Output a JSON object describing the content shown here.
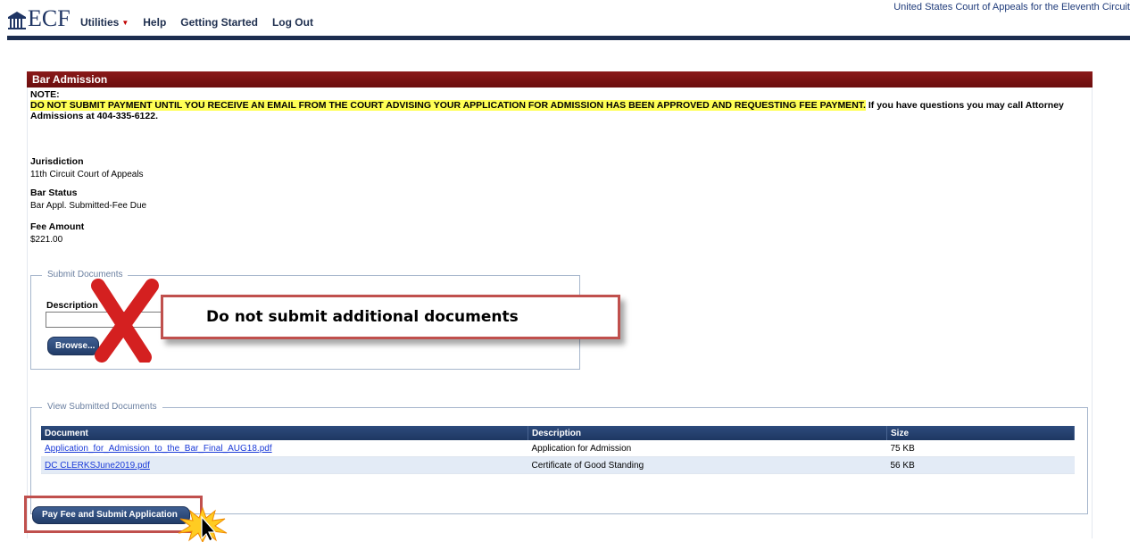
{
  "app": {
    "logo_text": "ECF",
    "court_name": "United States Court of Appeals for the Eleventh Circuit"
  },
  "menu": {
    "utilities": "Utilities",
    "help": "Help",
    "getting_started": "Getting Started",
    "log_out": "Log Out"
  },
  "panel": {
    "title": "Bar Admission",
    "note_label": "NOTE:",
    "note_highlight": "DO NOT SUBMIT PAYMENT UNTIL YOU RECEIVE AN EMAIL FROM THE COURT ADVISING YOUR APPLICATION FOR ADMISSION HAS BEEN APPROVED AND REQUESTING FEE PAYMENT.",
    "note_rest": " If you have questions you may call Attorney Admissions at 404-335-6122."
  },
  "fields": {
    "jurisdiction_label": "Jurisdiction",
    "jurisdiction_value": "11th Circuit Court of Appeals",
    "bar_status_label": "Bar Status",
    "bar_status_value": "Bar Appl. Submitted-Fee Due",
    "fee_amount_label": "Fee Amount",
    "fee_amount_value": "$221.00"
  },
  "submit_documents": {
    "legend": "Submit Documents",
    "description_label": "Description",
    "description_value": "",
    "browse_label": "Browse..."
  },
  "callout": {
    "text": "Do not submit additional documents"
  },
  "view_documents": {
    "legend": "View Submitted Documents",
    "columns": [
      "Document",
      "Description",
      "Size"
    ],
    "rows": [
      {
        "document": "Application_for_Admission_to_the_Bar_Final_AUG18.pdf",
        "description": "Application for Admission",
        "size": "75 KB"
      },
      {
        "document": "DC CLERKSJune2019.pdf",
        "description": "Certificate of Good Standing",
        "size": "56 KB"
      }
    ]
  },
  "actions": {
    "pay_label": "Pay Fee and Submit Application"
  },
  "colors": {
    "header_bar": "#7a1313",
    "nav_line": "#1c2d4f",
    "highlight": "#ffff55",
    "annotation_red": "#c0504d",
    "button_blue": "#213c68"
  }
}
